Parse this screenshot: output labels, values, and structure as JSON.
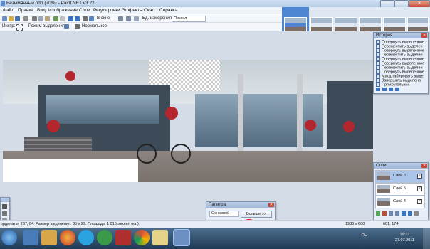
{
  "window": {
    "title": "Безымянный.pdn (70%) - Paint.NET v3.22"
  },
  "menu": [
    "Файл",
    "Правка",
    "Вид",
    "Изображение",
    "Слои",
    "Регулировки",
    "Эффекты",
    "Окно",
    "Справка"
  ],
  "toolbar1": {
    "fit_label": "В окне",
    "units_label": "Ед. измерения:",
    "units_value": "Пиксел"
  },
  "toolbar2": {
    "tool_label": "Инстр:",
    "selection_mode_label": "Режим выделения:",
    "blend_mode_value": "Нормальное"
  },
  "history": {
    "title": "История",
    "items": [
      "Повернуть выделенное",
      "Переместить выделен",
      "Повернуть выделенное",
      "Переместить выделен",
      "Повернуть выделенное",
      "Повернуть выделенное",
      "Переместить выделен",
      "Повернуть выделенное",
      "Масштабировать выде",
      "Завершить выделено",
      "Прямоугольник"
    ]
  },
  "layers": {
    "title": "Слои",
    "items": [
      {
        "name": "Слой 6",
        "visible": "✓"
      },
      {
        "name": "Слой 5",
        "visible": "✓"
      },
      {
        "name": "Слой 4",
        "visible": "✓"
      }
    ]
  },
  "palette": {
    "title": "Палитра",
    "mode_value": "Основной",
    "more_button": "Больше >>"
  },
  "status": {
    "left": "ординаты: 237, 84. Размер выделения: 35 x 29. Площадь: 1 015 пиксел (кв.)",
    "size": "1936 x 600",
    "cursor": "601, 174"
  },
  "taskbar": {
    "apps": [
      "start-button",
      "explorer",
      "firefox",
      "skype",
      "utorrent",
      "chrome",
      "paint-net",
      "notepad",
      "screen-tool"
    ],
    "lang": "RU",
    "time": "19:33",
    "date": "27.07.2011"
  },
  "colors": {
    "accent": "#3f75c0",
    "titlebar": "#b7cde6",
    "taskbar": "#1f3a55",
    "selected_layer": "#a9c4e8"
  }
}
